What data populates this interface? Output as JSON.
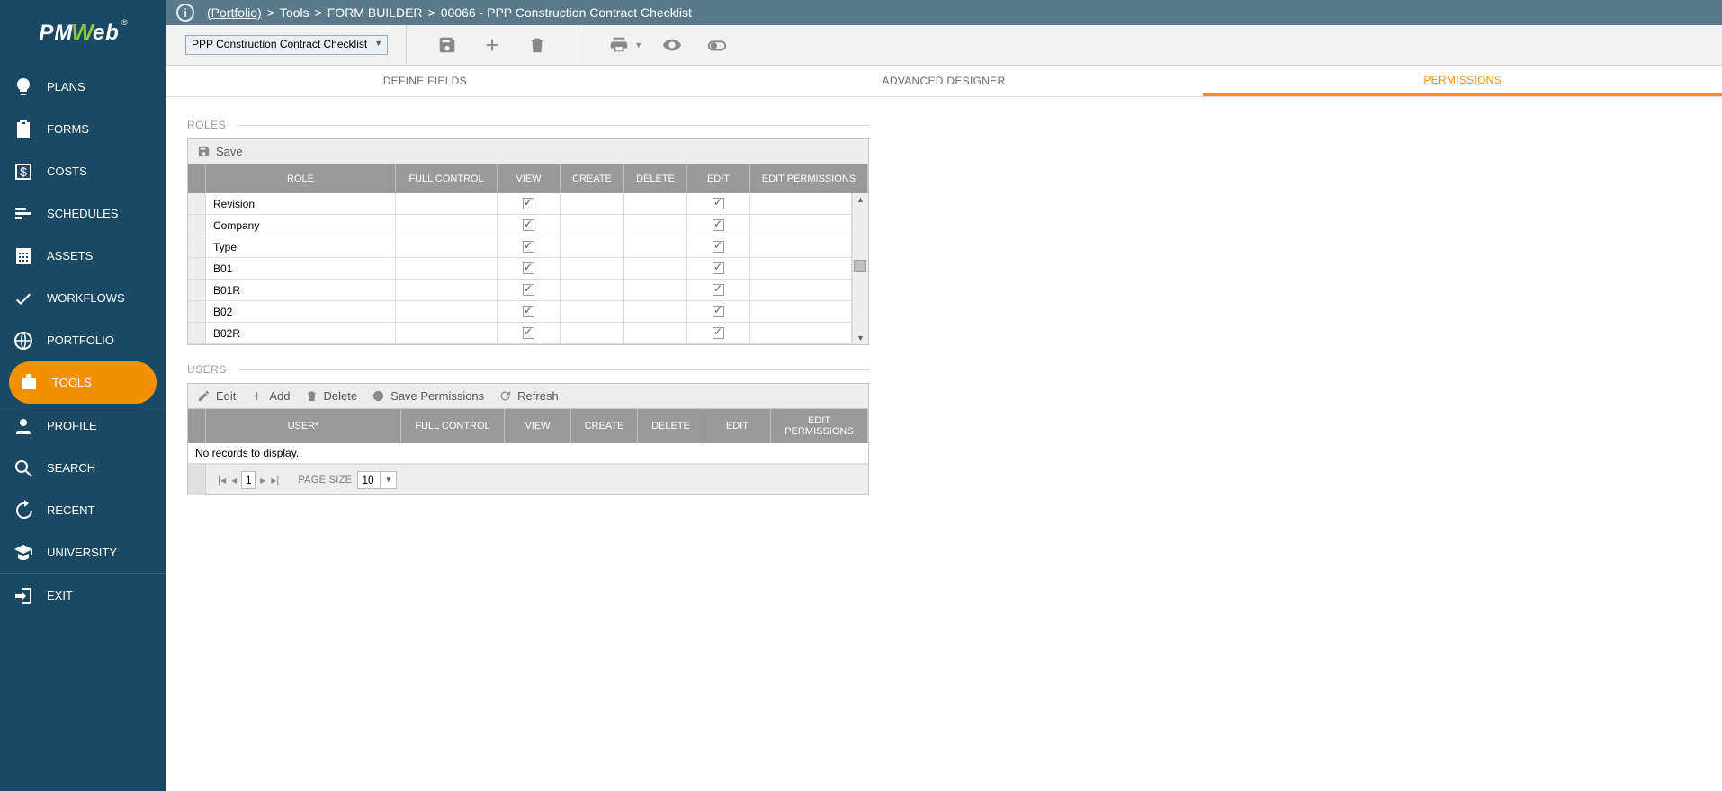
{
  "breadcrumb": {
    "portfolio": "(Portfolio)",
    "tools": "Tools",
    "formbuilder": "FORM BUILDER",
    "record": "00066 - PPP Construction Contract Checklist"
  },
  "recordSelect": "PPP Construction Contract Checklist",
  "sidebar": [
    {
      "key": "plans",
      "label": "PLANS"
    },
    {
      "key": "forms",
      "label": "FORMS"
    },
    {
      "key": "costs",
      "label": "COSTS"
    },
    {
      "key": "schedules",
      "label": "SCHEDULES"
    },
    {
      "key": "assets",
      "label": "ASSETS"
    },
    {
      "key": "workflows",
      "label": "WORKFLOWS"
    },
    {
      "key": "portfolio",
      "label": "PORTFOLIO"
    },
    {
      "key": "tools",
      "label": "TOOLS"
    },
    {
      "key": "profile",
      "label": "PROFILE"
    },
    {
      "key": "search",
      "label": "SEARCH"
    },
    {
      "key": "recent",
      "label": "RECENT"
    },
    {
      "key": "university",
      "label": "UNIVERSITY"
    },
    {
      "key": "exit",
      "label": "EXIT"
    }
  ],
  "tabs": {
    "define": "DEFINE FIELDS",
    "designer": "ADVANCED DESIGNER",
    "permissions": "PERMISSIONS"
  },
  "roles": {
    "title": "ROLES",
    "saveLabel": "Save",
    "headers": {
      "role": "ROLE",
      "fullControl": "FULL CONTROL",
      "view": "VIEW",
      "create": "CREATE",
      "delete": "DELETE",
      "edit": "EDIT",
      "editPerm": "EDIT PERMISSIONS"
    },
    "rows": [
      {
        "role": "Revision",
        "fullControl": false,
        "view": true,
        "create": false,
        "delete": false,
        "edit": true,
        "editPerm": false
      },
      {
        "role": "Company",
        "fullControl": false,
        "view": true,
        "create": false,
        "delete": false,
        "edit": true,
        "editPerm": false
      },
      {
        "role": "Type",
        "fullControl": false,
        "view": true,
        "create": false,
        "delete": false,
        "edit": true,
        "editPerm": false
      },
      {
        "role": "B01",
        "fullControl": false,
        "view": true,
        "create": false,
        "delete": false,
        "edit": true,
        "editPerm": false
      },
      {
        "role": "B01R",
        "fullControl": false,
        "view": true,
        "create": false,
        "delete": false,
        "edit": true,
        "editPerm": false
      },
      {
        "role": "B02",
        "fullControl": false,
        "view": true,
        "create": false,
        "delete": false,
        "edit": true,
        "editPerm": false
      },
      {
        "role": "B02R",
        "fullControl": false,
        "view": true,
        "create": false,
        "delete": false,
        "edit": true,
        "editPerm": false
      }
    ]
  },
  "users": {
    "title": "USERS",
    "toolbar": {
      "edit": "Edit",
      "add": "Add",
      "delete": "Delete",
      "savePerm": "Save Permissions",
      "refresh": "Refresh"
    },
    "headers": {
      "user": "USER*",
      "fullControl": "FULL CONTROL",
      "view": "VIEW",
      "create": "CREATE",
      "delete": "DELETE",
      "edit": "EDIT",
      "editPerm": "EDIT PERMISSIONS"
    },
    "noRecords": "No records to display.",
    "pager": {
      "page": "1",
      "pageSizeLabel": "PAGE SIZE",
      "pageSize": "10"
    }
  }
}
